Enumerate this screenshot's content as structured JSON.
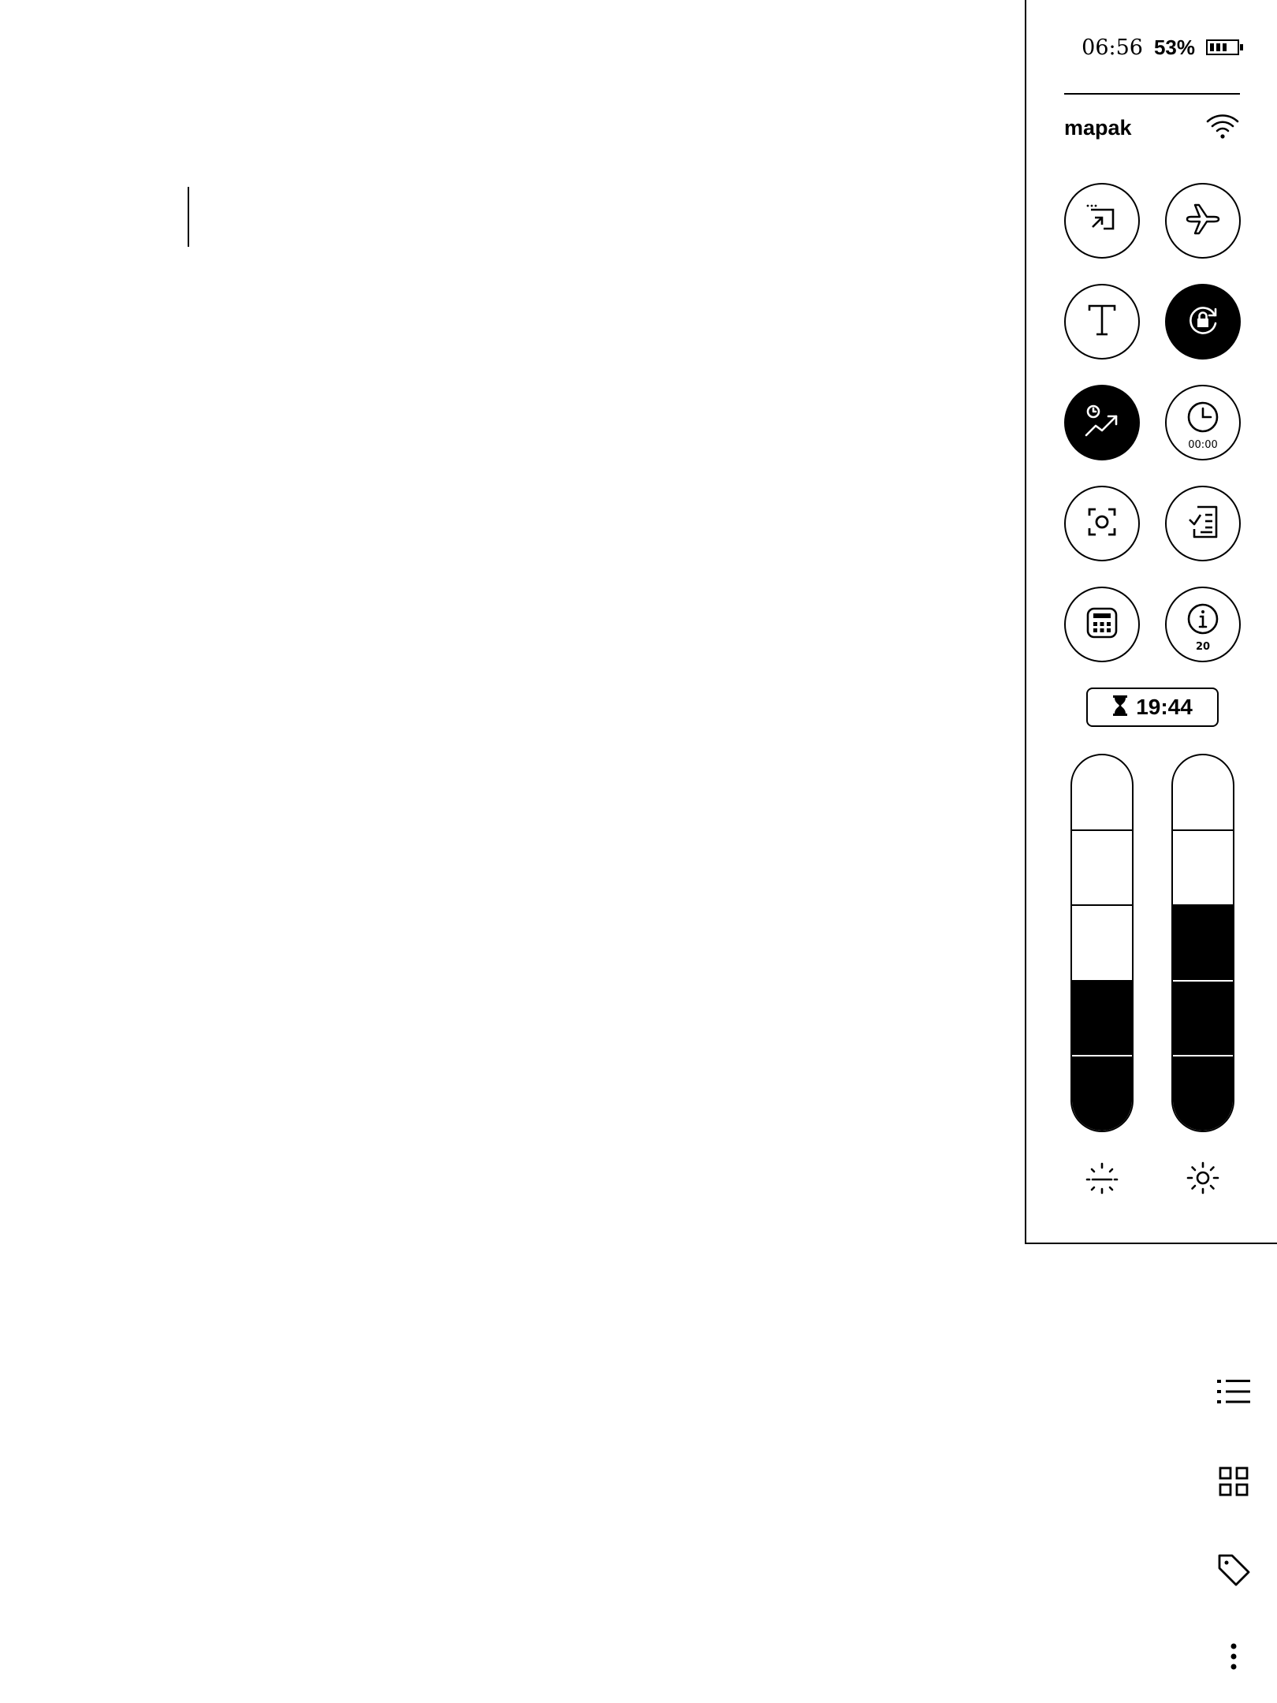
{
  "status": {
    "time": "06:56",
    "battery_percent": "53%",
    "battery_level": 0.53
  },
  "network": {
    "name": "mapak",
    "icon": "wifi-icon"
  },
  "quick_toggles": [
    {
      "name": "screen-cast",
      "icon": "cast-icon",
      "active": false
    },
    {
      "name": "airplane-mode",
      "icon": "airplane-icon",
      "active": false
    },
    {
      "name": "font-settings",
      "icon": "text-t-icon",
      "active": false
    },
    {
      "name": "rotation-lock",
      "icon": "rotation-lock-icon",
      "active": true
    },
    {
      "name": "reading-stats",
      "icon": "stats-trend-icon",
      "active": true
    },
    {
      "name": "reading-timer",
      "icon": "clock-icon",
      "active": false,
      "sub": "00:00"
    },
    {
      "name": "screenshot",
      "icon": "screenshot-icon",
      "active": false
    },
    {
      "name": "tasks",
      "icon": "checklist-icon",
      "active": false
    },
    {
      "name": "calculator",
      "icon": "calculator-icon",
      "active": false
    },
    {
      "name": "info",
      "icon": "info-icon",
      "active": false,
      "sub": "20"
    }
  ],
  "sleep_timer": {
    "icon": "hourglass-icon",
    "value": "19:44"
  },
  "sliders": {
    "warmth": {
      "icon": "warm-light-icon",
      "level": 0.4,
      "segments": 5
    },
    "brightness": {
      "icon": "brightness-icon",
      "level": 0.6,
      "segments": 5
    }
  },
  "side_toolbar": [
    {
      "name": "toc",
      "icon": "list-icon"
    },
    {
      "name": "grid-view",
      "icon": "grid-icon"
    },
    {
      "name": "tags",
      "icon": "tag-icon"
    },
    {
      "name": "more",
      "icon": "more-vertical-icon"
    }
  ],
  "colors": {
    "ink": "#000000",
    "paper": "#ffffff"
  }
}
